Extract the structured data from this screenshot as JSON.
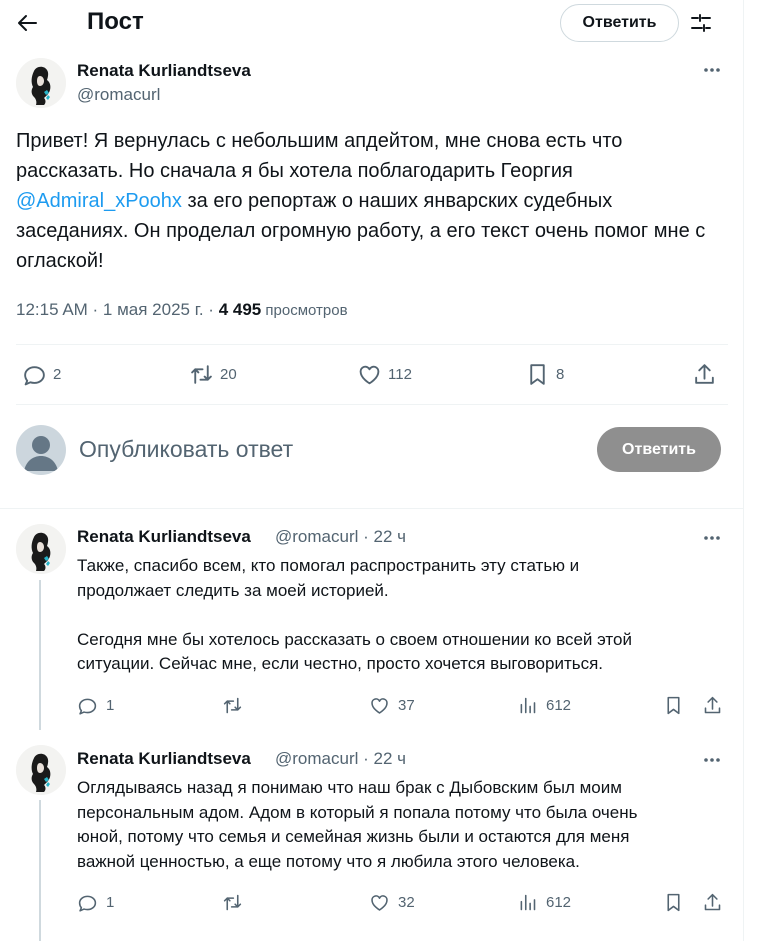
{
  "header": {
    "title": "Пост",
    "reply_button": "Ответить"
  },
  "main_post": {
    "author": "Renata Kurliandtseva",
    "handle": "@romacurl",
    "text_before": "Привет! Я вернулась с небольшим апдейтом, мне снова есть что рассказать. Но сначала я бы хотела поблагодарить Георгия ",
    "mention": "@Admiral_xPoohx",
    "text_after": " за его репортаж о наших январских судебных заседаниях. Он проделал огромную работу, а его текст очень помог мне с оглаской!",
    "time": "12:15 AM · 1 мая 2025 г. · ",
    "views": "4 495",
    "views_label": " просмотров",
    "stats": {
      "replies": "2",
      "reposts": "20",
      "likes": "112",
      "bookmarks": "8"
    }
  },
  "compose": {
    "placeholder": "Опубликовать ответ",
    "button": "Ответить"
  },
  "replies": [
    {
      "author": "Renata Kurliandtseva",
      "handle": "@romacurl · 22 ч",
      "text": "Также, спасибо всем, кто помогал распространить эту статью и\nпродолжает следить за моей историей.\n\nСегодня мне бы хотелось рассказать о своем отношении ко всей этой\nситуации. Сейчас мне, если честно, просто хочется выговориться.",
      "stats": {
        "replies": "1",
        "reposts": "",
        "likes": "37",
        "views": "612"
      }
    },
    {
      "author": "Renata Kurliandtseva",
      "handle": "@romacurl · 22 ч",
      "text": "Оглядываясь назад я понимаю что наш брак с Дыбовским был моим\nперсональным адом. Адом в который я попала потому что была очень\nюной, потому что семья и семейная жизнь были и остаются для меня\nважной ценностью, а еще потому что я любила этого человека.",
      "stats": {
        "replies": "1",
        "reposts": "",
        "likes": "32",
        "views": "612"
      }
    }
  ]
}
